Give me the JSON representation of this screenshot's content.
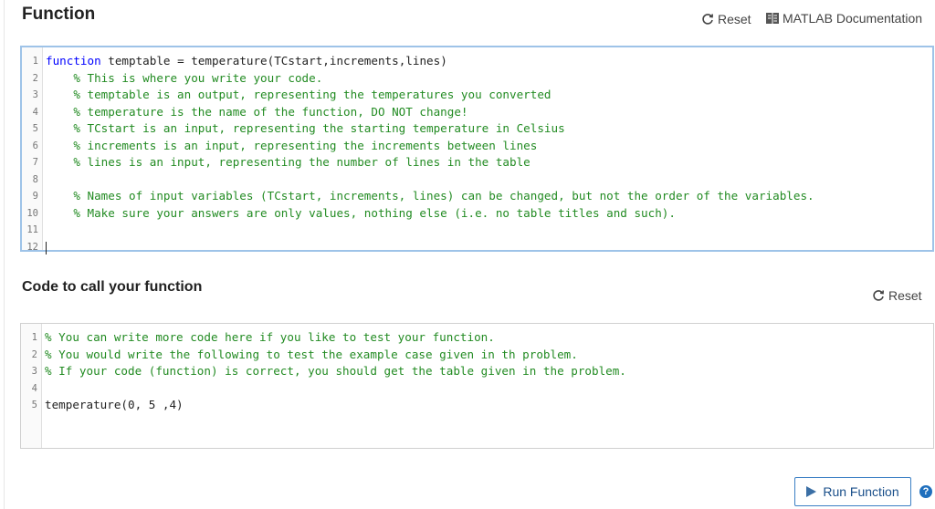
{
  "header": {
    "title": "Function",
    "reset_label": "Reset",
    "doc_label": "MATLAB Documentation"
  },
  "function_editor": {
    "lines": [
      {
        "n": "1",
        "kw": "function",
        "text": " temptable = temperature(TCstart,increments,lines)"
      },
      {
        "n": "2",
        "text": "    % This is where you write your code."
      },
      {
        "n": "3",
        "text": "    % temptable is an output, representing the temperatures you converted"
      },
      {
        "n": "4",
        "text": "    % temperature is the name of the function, DO NOT change!"
      },
      {
        "n": "5",
        "text": "    % TCstart is an input, representing the starting temperature in Celsius"
      },
      {
        "n": "6",
        "text": "    % increments is an input, representing the increments between lines"
      },
      {
        "n": "7",
        "text": "    % lines is an input, representing the number of lines in the table"
      },
      {
        "n": "8",
        "text": ""
      },
      {
        "n": "9",
        "text": "    % Names of input variables (TCstart, increments, lines) can be changed, but not the order of the variables."
      },
      {
        "n": "10",
        "text": "    % Make sure your answers are only values, nothing else (i.e. no table titles and such)."
      },
      {
        "n": "11",
        "text": ""
      },
      {
        "n": "12",
        "text": ""
      }
    ]
  },
  "call_section": {
    "title": "Code to call your function",
    "reset_label": "Reset",
    "lines": [
      {
        "n": "1",
        "text": "% You can write more code here if you like to test your function."
      },
      {
        "n": "2",
        "text": "% You would write the following to test the example case given in th problem."
      },
      {
        "n": "3",
        "text": "% If your code (function) is correct, you should get the table given in the problem."
      },
      {
        "n": "4",
        "text": ""
      },
      {
        "n": "5",
        "text": "temperature(0, 5 ,4)"
      }
    ]
  },
  "footer": {
    "run_label": "Run Function",
    "help_glyph": "?"
  },
  "colors": {
    "keyword": "#0000ff",
    "comment": "#228b22",
    "accent": "#1f6fbd"
  }
}
